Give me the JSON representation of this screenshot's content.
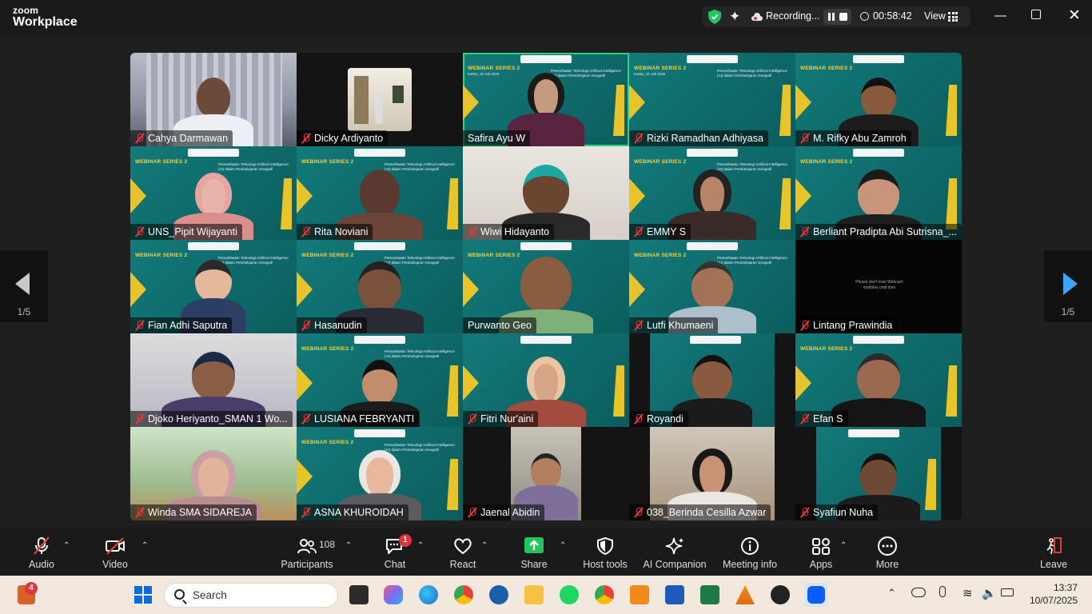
{
  "app": {
    "brand_top": "zoom",
    "brand_bottom": "Workplace"
  },
  "meeting_bar": {
    "recording_label": "Recording...",
    "timer": "00:58:42",
    "view_label": "View"
  },
  "pager": {
    "left": "1/5",
    "right": "1/5"
  },
  "participants": [
    {
      "name": "Cahya Darmawan"
    },
    {
      "name": "Dicky Ardiyanto"
    },
    {
      "name": "Safira Ayu W"
    },
    {
      "name": "Rizki Ramadhan Adhiyasa"
    },
    {
      "name": "M. Rifky Abu Zamroh"
    },
    {
      "name": "UNS_Pipit Wijayanti"
    },
    {
      "name": "Rita Noviani"
    },
    {
      "name": "Wiwi Hidayanto"
    },
    {
      "name": "EMMY S"
    },
    {
      "name": "Berliant Pradipta Abi Sutrisna_..."
    },
    {
      "name": "Fian Adhi Saputra"
    },
    {
      "name": "Hasanudin"
    },
    {
      "name": "Purwanto Geo"
    },
    {
      "name": "Lutfi Khumaeni"
    },
    {
      "name": "Lintang Prawindia"
    },
    {
      "name": "Djoko Heriyanto_SMAN 1 Wo..."
    },
    {
      "name": "LUSIANA FEBRYANTI"
    },
    {
      "name": "Fitri Nur'aini"
    },
    {
      "name": "Royandi"
    },
    {
      "name": "Efan S"
    },
    {
      "name": "Winda SMA SIDAREJA"
    },
    {
      "name": "ASNA KHUROIDAH"
    },
    {
      "name": "Jaenal Abidin"
    },
    {
      "name": "038_Berinda Cesilla Azwar"
    },
    {
      "name": "Syafiun Nuha"
    }
  ],
  "webinar": {
    "banner": "WEBINAR SERIES 2",
    "date": "Kamis, 10 Juli 2025",
    "theme": "Pemanfaatan Teknologi Artificial Intelligence (AI) dalam Pembelajaran Geografi"
  },
  "black_tile_text": "Please don't train Webcam modules until then",
  "toolbar": {
    "audio": "Audio",
    "video": "Video",
    "participants": "Participants",
    "participants_count": "108",
    "chat": "Chat",
    "chat_badge": "1",
    "react": "React",
    "share": "Share",
    "host_tools": "Host tools",
    "ai_companion": "AI Companion",
    "meeting_info": "Meeting info",
    "apps": "Apps",
    "more": "More",
    "leave": "Leave"
  },
  "taskbar": {
    "search_placeholder": "Search",
    "widget_badge": "4",
    "time": "13:37",
    "date": "10/07/2025"
  },
  "colors": {
    "accent": "#2fd47a",
    "danger": "#e23b3b",
    "share": "#22c55e",
    "teal": "#137a7a",
    "gold": "#e7c52a"
  }
}
